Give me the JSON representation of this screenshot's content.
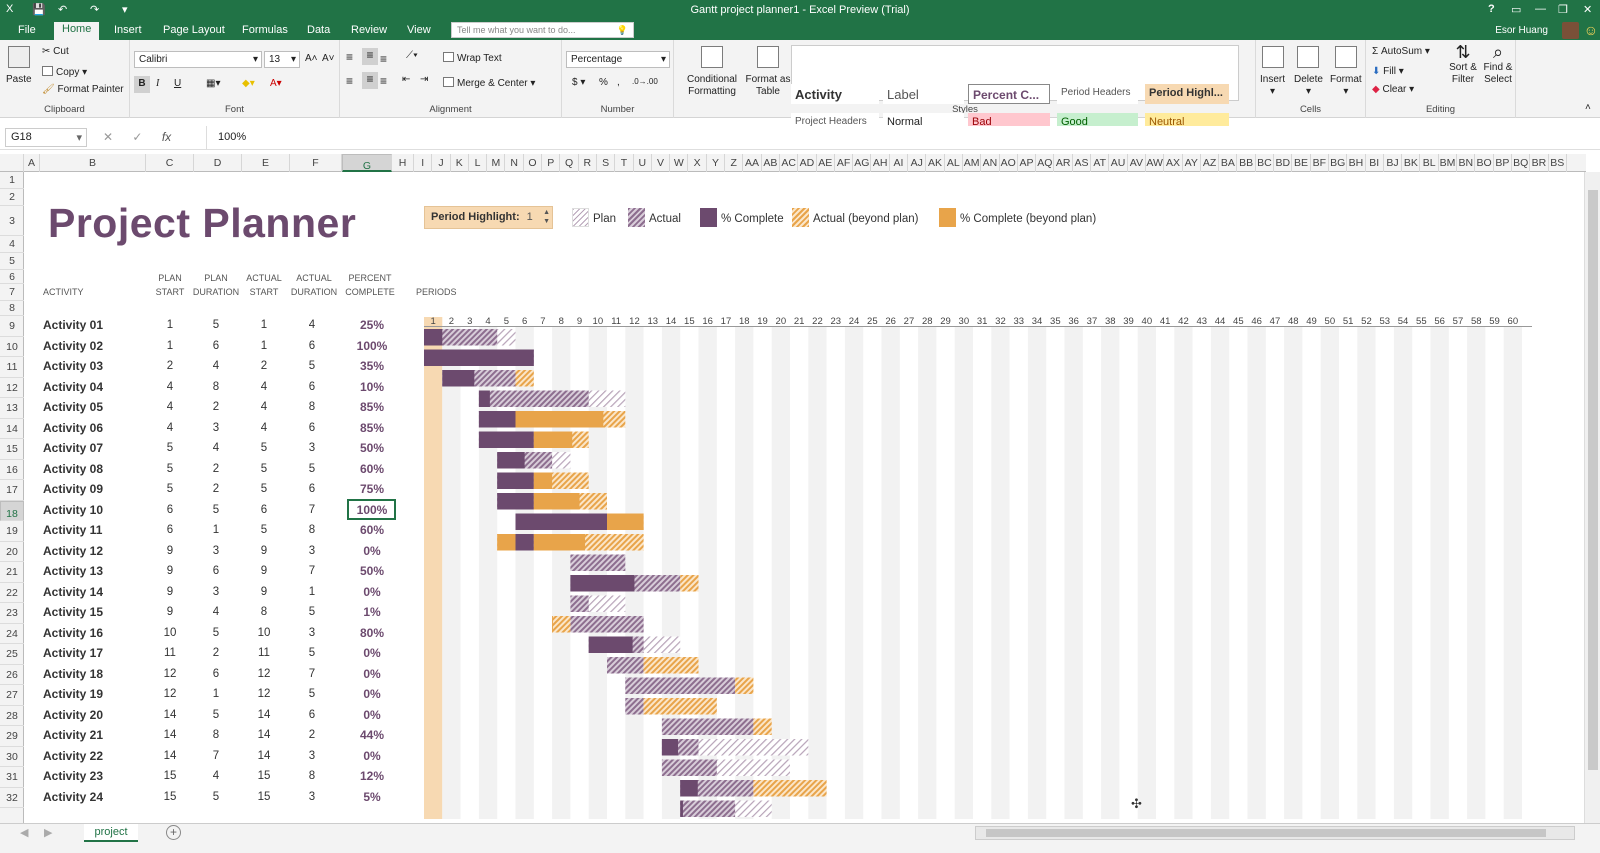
{
  "window": {
    "title": "Gantt project planner1 - Excel Preview (Trial)",
    "user": "Esor Huang",
    "help": "?"
  },
  "qat": [
    "X",
    "💾",
    "↶",
    "↷",
    "▾"
  ],
  "ribbon_tabs": [
    "File",
    "Home",
    "Insert",
    "Page Layout",
    "Formulas",
    "Data",
    "Review",
    "View"
  ],
  "active_tab": "Home",
  "tell_me": "Tell me what you want to do...",
  "clipboard": {
    "paste": "Paste",
    "cut": "Cut",
    "copy": "Copy",
    "painter": "Format Painter",
    "label": "Clipboard"
  },
  "font": {
    "name": "Calibri",
    "size": "13",
    "bold": "B",
    "italic": "I",
    "underline": "U",
    "label": "Font",
    "grow": "A˄",
    "shrink": "A˅"
  },
  "alignment": {
    "wrap": "Wrap Text",
    "merge": "Merge & Center",
    "label": "Alignment"
  },
  "number": {
    "format": "Percentage",
    "currency": "$",
    "percent": "%",
    "comma": ",",
    "label": "Number",
    "inc": ".0→.00",
    "dec": ".00→.0"
  },
  "styles_group": {
    "conditional": "Conditional Formatting",
    "format_table": "Format as Table",
    "label": "Styles",
    "cells": [
      {
        "text": "Activity",
        "bg": "#ffffff",
        "color": "#333333"
      },
      {
        "text": "Label",
        "bg": "#ffffff",
        "color": "#555555"
      },
      {
        "text": "Percent C...",
        "bg": "#ffffff",
        "color": "#6c4a6e"
      },
      {
        "text": "Period Headers",
        "bg": "#ffffff",
        "color": "#555555"
      },
      {
        "text": "Period Highl...",
        "bg": "#f7d9b2",
        "color": "#333333"
      },
      {
        "text": "Project Headers",
        "bg": "#ffffff",
        "color": "#555555"
      },
      {
        "text": "Normal",
        "bg": "#ffffff",
        "color": "#222222"
      },
      {
        "text": "Bad",
        "bg": "#ffc7ce",
        "color": "#9c0006"
      },
      {
        "text": "Good",
        "bg": "#c6efce",
        "color": "#006100"
      },
      {
        "text": "Neutral",
        "bg": "#ffeb9c",
        "color": "#9c5700"
      }
    ]
  },
  "cells_group": {
    "insert": "Insert",
    "delete": "Delete",
    "format": "Format",
    "label": "Cells"
  },
  "editing": {
    "autosum": "AutoSum",
    "fill": "Fill",
    "clear": "Clear",
    "sort": "Sort & Filter",
    "find": "Find & Select",
    "label": "Editing"
  },
  "formula_bar": {
    "name_box": "G18",
    "fx": "fx",
    "cancel": "✕",
    "enter": "✓",
    "value": "100%"
  },
  "columns": [
    "A",
    "B",
    "C",
    "D",
    "E",
    "F",
    "G",
    "H",
    "I",
    "J",
    "K",
    "L",
    "M",
    "N",
    "O",
    "P",
    "Q",
    "R",
    "S",
    "T",
    "U",
    "V",
    "W",
    "X",
    "Y",
    "Z",
    "AA",
    "AB",
    "AC",
    "AD",
    "AE",
    "AF",
    "AG",
    "AH",
    "AI",
    "AJ",
    "AK",
    "AL",
    "AM",
    "AN",
    "AO",
    "AP",
    "AQ",
    "AR",
    "AS",
    "AT",
    "AU",
    "AV",
    "AW",
    "AX",
    "AY",
    "AZ",
    "BA",
    "BB",
    "BC",
    "BD",
    "BE",
    "BF",
    "BG",
    "BH",
    "BI",
    "BJ",
    "BK",
    "BL",
    "BM",
    "BN",
    "BO",
    "BP",
    "BQ",
    "BR",
    "BS"
  ],
  "rows": [
    "1",
    "2",
    "3",
    "4",
    "5",
    "6",
    "7",
    "8",
    "9",
    "10",
    "11",
    "12",
    "13",
    "14",
    "15",
    "16",
    "17",
    "18",
    "19",
    "20",
    "21",
    "22",
    "23",
    "24",
    "25",
    "26",
    "27",
    "28",
    "29",
    "30",
    "31",
    "32"
  ],
  "selected_col": "G",
  "selected_row": "18",
  "sheet": {
    "title": "Project Planner",
    "period_highlight_label": "Period Highlight:",
    "period_highlight_value": "1",
    "periods_label": "PERIODS",
    "headers": {
      "activity": "ACTIVITY",
      "plan_start": "PLAN START",
      "plan_duration": "PLAN DURATION",
      "actual_start": "ACTUAL START",
      "actual_duration": "ACTUAL DURATION",
      "percent_complete": "PERCENT COMPLETE"
    },
    "legend": [
      "Plan",
      "Actual",
      "% Complete",
      "Actual (beyond plan)",
      "% Complete (beyond plan)"
    ],
    "period_count": 60,
    "activities": [
      {
        "name": "Activity 01",
        "ps": 1,
        "pd": 5,
        "as": 1,
        "ad": 4,
        "pct": "25%"
      },
      {
        "name": "Activity 02",
        "ps": 1,
        "pd": 6,
        "as": 1,
        "ad": 6,
        "pct": "100%"
      },
      {
        "name": "Activity 03",
        "ps": 2,
        "pd": 4,
        "as": 2,
        "ad": 5,
        "pct": "35%"
      },
      {
        "name": "Activity 04",
        "ps": 4,
        "pd": 8,
        "as": 4,
        "ad": 6,
        "pct": "10%"
      },
      {
        "name": "Activity 05",
        "ps": 4,
        "pd": 2,
        "as": 4,
        "ad": 8,
        "pct": "85%"
      },
      {
        "name": "Activity 06",
        "ps": 4,
        "pd": 3,
        "as": 4,
        "ad": 6,
        "pct": "85%"
      },
      {
        "name": "Activity 07",
        "ps": 5,
        "pd": 4,
        "as": 5,
        "ad": 3,
        "pct": "50%"
      },
      {
        "name": "Activity 08",
        "ps": 5,
        "pd": 2,
        "as": 5,
        "ad": 5,
        "pct": "60%"
      },
      {
        "name": "Activity 09",
        "ps": 5,
        "pd": 2,
        "as": 5,
        "ad": 6,
        "pct": "75%"
      },
      {
        "name": "Activity 10",
        "ps": 6,
        "pd": 5,
        "as": 6,
        "ad": 7,
        "pct": "100%"
      },
      {
        "name": "Activity 11",
        "ps": 6,
        "pd": 1,
        "as": 5,
        "ad": 8,
        "pct": "60%"
      },
      {
        "name": "Activity 12",
        "ps": 9,
        "pd": 3,
        "as": 9,
        "ad": 3,
        "pct": "0%"
      },
      {
        "name": "Activity 13",
        "ps": 9,
        "pd": 6,
        "as": 9,
        "ad": 7,
        "pct": "50%"
      },
      {
        "name": "Activity 14",
        "ps": 9,
        "pd": 3,
        "as": 9,
        "ad": 1,
        "pct": "0%"
      },
      {
        "name": "Activity 15",
        "ps": 9,
        "pd": 4,
        "as": 8,
        "ad": 5,
        "pct": "1%"
      },
      {
        "name": "Activity 16",
        "ps": 10,
        "pd": 5,
        "as": 10,
        "ad": 3,
        "pct": "80%"
      },
      {
        "name": "Activity 17",
        "ps": 11,
        "pd": 2,
        "as": 11,
        "ad": 5,
        "pct": "0%"
      },
      {
        "name": "Activity 18",
        "ps": 12,
        "pd": 6,
        "as": 12,
        "ad": 7,
        "pct": "0%"
      },
      {
        "name": "Activity 19",
        "ps": 12,
        "pd": 1,
        "as": 12,
        "ad": 5,
        "pct": "0%"
      },
      {
        "name": "Activity 20",
        "ps": 14,
        "pd": 5,
        "as": 14,
        "ad": 6,
        "pct": "0%"
      },
      {
        "name": "Activity 21",
        "ps": 14,
        "pd": 8,
        "as": 14,
        "ad": 2,
        "pct": "44%"
      },
      {
        "name": "Activity 22",
        "ps": 14,
        "pd": 7,
        "as": 14,
        "ad": 3,
        "pct": "0%"
      },
      {
        "name": "Activity 23",
        "ps": 15,
        "pd": 4,
        "as": 15,
        "ad": 8,
        "pct": "12%"
      },
      {
        "name": "Activity 24",
        "ps": 15,
        "pd": 5,
        "as": 15,
        "ad": 3,
        "pct": "5%"
      }
    ]
  },
  "sheet_tab": "project",
  "colors": {
    "excel_green": "#217346",
    "plan": "#b7a3b8",
    "actual": "#8d6e8f",
    "complete": "#6c4a6e",
    "beyond": "#e8a44a",
    "highlight": "#f7d9b2"
  }
}
